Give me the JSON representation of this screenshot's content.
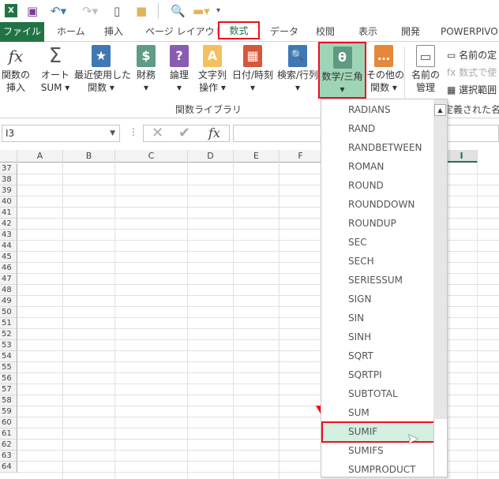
{
  "qat": {
    "icons": [
      "excel-icon",
      "save-icon",
      "undo-icon",
      "redo-icon",
      "new-icon",
      "open-folder-icon",
      "print-preview-icon",
      "folder-icon",
      "customize-icon"
    ]
  },
  "tabs": [
    {
      "label": "ファイル"
    },
    {
      "label": "ホーム"
    },
    {
      "label": "挿入"
    },
    {
      "label": "ページ レイアウト"
    },
    {
      "label": "数式"
    },
    {
      "label": "データ"
    },
    {
      "label": "校閲"
    },
    {
      "label": "表示"
    },
    {
      "label": "開発"
    },
    {
      "label": "POWERPIVO"
    }
  ],
  "ribbon": {
    "buttons": [
      {
        "l1": "関数の",
        "l2": "挿入",
        "glyph": "fx",
        "color": "#ffffff"
      },
      {
        "l1": "オート",
        "l2": "SUM ▾",
        "glyph": "Σ",
        "color": "#ffffff"
      },
      {
        "l1": "最近使用した",
        "l2": "関数 ▾",
        "glyph": "★",
        "color": "#3f78b5"
      },
      {
        "l1": "財務",
        "l2": "▾",
        "glyph": "$",
        "color": "#5f9c85"
      },
      {
        "l1": "論理",
        "l2": "▾",
        "glyph": "?",
        "color": "#8a5bb3"
      },
      {
        "l1": "文字列",
        "l2": "操作 ▾",
        "glyph": "A",
        "color": "#f2c05e"
      },
      {
        "l1": "日付/時刻",
        "l2": "▾",
        "glyph": "▦",
        "color": "#d6573c"
      },
      {
        "l1": "検索/行列",
        "l2": "▾",
        "glyph": "🔍",
        "color": "#3f78b5"
      },
      {
        "l1": "数学/三角",
        "l2": "▾",
        "glyph": "θ",
        "color": "#5e9a82"
      },
      {
        "l1": "その他の",
        "l2": "関数 ▾",
        "glyph": "…",
        "color": "#e6883c"
      },
      {
        "l1": "名前の",
        "l2": "管理",
        "glyph": "▭",
        "color": "#ffffff"
      }
    ],
    "group_label": "関数ライブラリ",
    "names_group": {
      "define": "名前の定",
      "use_in_formula": "数式で使",
      "from_selection": "選択範囲",
      "label": "定義された名前"
    }
  },
  "formula_bar": {
    "name_box": "I3",
    "formula": ""
  },
  "columns": [
    "A",
    "B",
    "C",
    "D",
    "E",
    "F",
    "I"
  ],
  "rows": [
    "37",
    "38",
    "39",
    "40",
    "41",
    "42",
    "43",
    "44",
    "45",
    "46",
    "47",
    "48",
    "49",
    "50",
    "51",
    "52",
    "53",
    "54",
    "55",
    "56",
    "57",
    "58",
    "59",
    "60",
    "61",
    "62",
    "63",
    "64"
  ],
  "dropdown": {
    "items": [
      "RADIANS",
      "RAND",
      "RANDBETWEEN",
      "ROMAN",
      "ROUND",
      "ROUNDDOWN",
      "ROUNDUP",
      "SEC",
      "SECH",
      "SERIESSUM",
      "SIGN",
      "SIN",
      "SINH",
      "SQRT",
      "SQRTPI",
      "SUBTOTAL",
      "SUM",
      "SUMIF",
      "SUMIFS",
      "SUMPRODUCT"
    ],
    "selected": "SUMIF"
  },
  "colors": {
    "accent": "#217346",
    "highlight": "#d3f0e0",
    "annotation": "#ff0000",
    "active_button": "#9fd5b7"
  }
}
